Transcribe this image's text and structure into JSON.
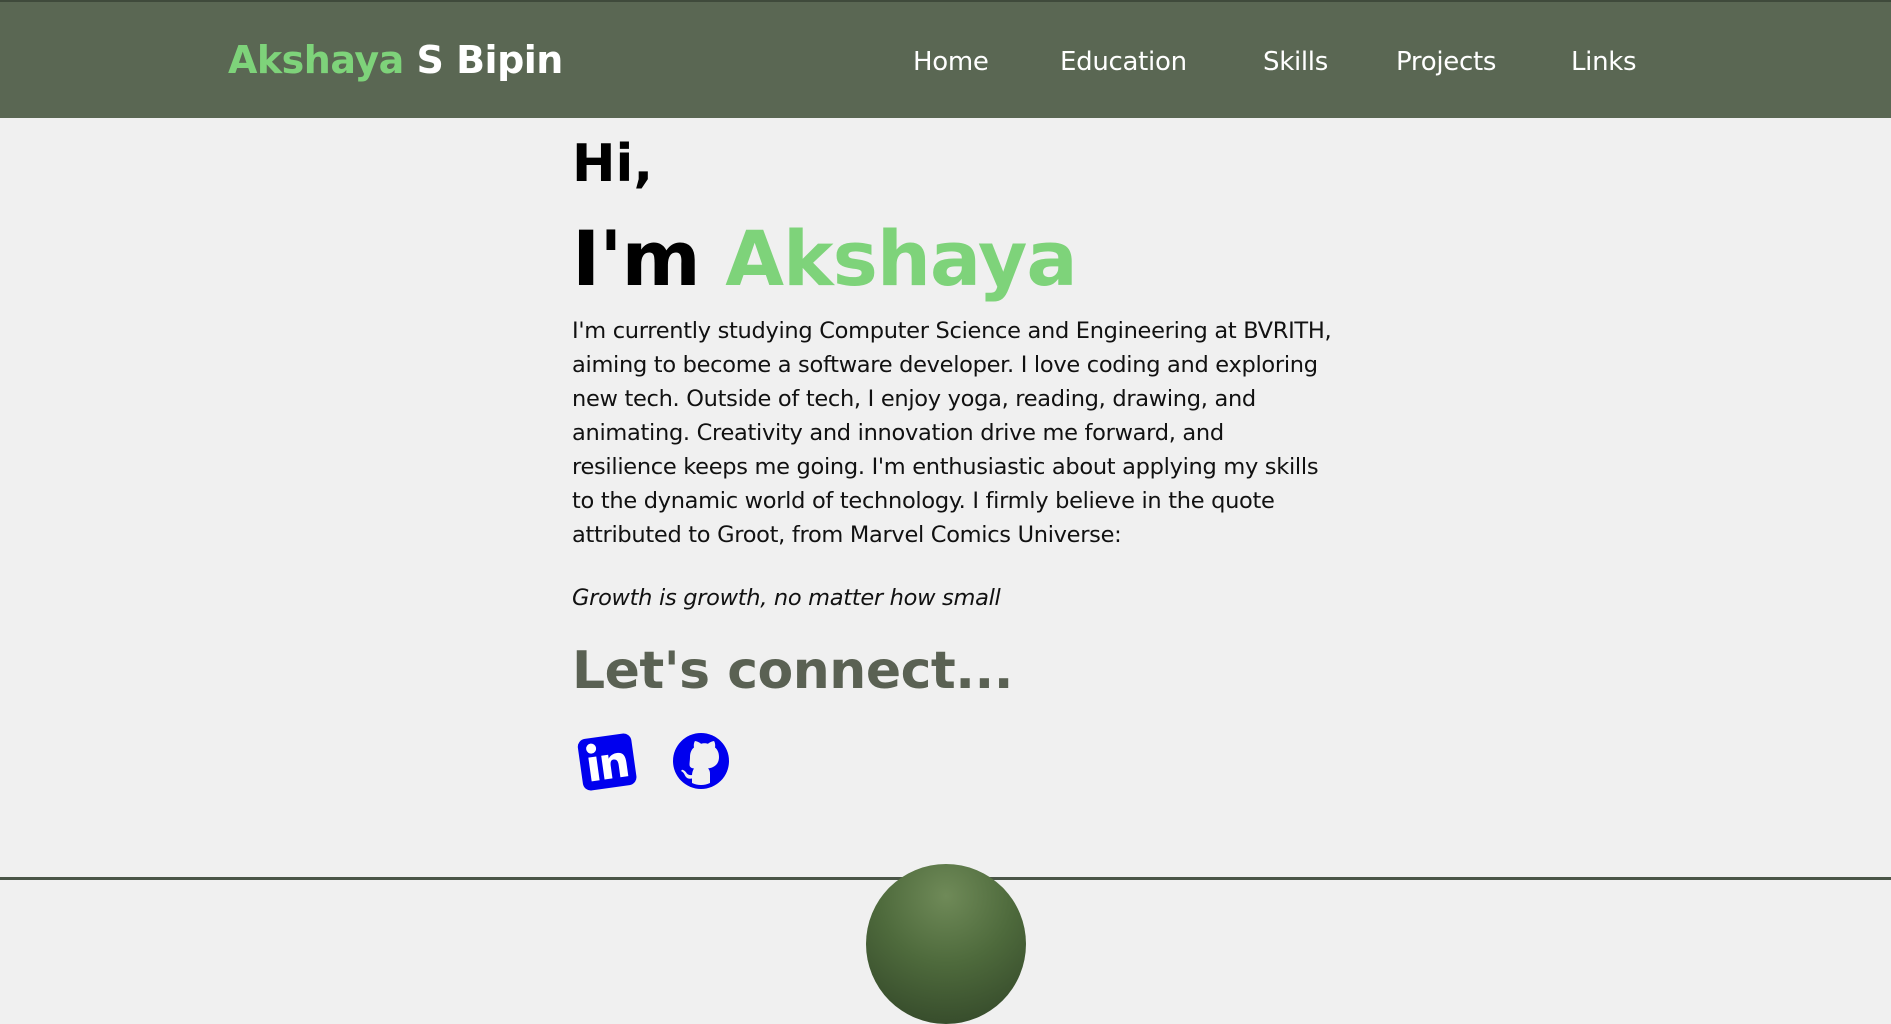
{
  "brand": {
    "first": "Akshaya",
    "rest": "S Bipin"
  },
  "nav": {
    "items": [
      {
        "label": "Home"
      },
      {
        "label": "Education"
      },
      {
        "label": "Skills"
      },
      {
        "label": "Projects"
      },
      {
        "label": "Links"
      }
    ]
  },
  "hero": {
    "greeting": "Hi,",
    "intro_prefix": "I'm",
    "intro_name": "Akshaya",
    "bio": "I'm currently studying Computer Science and Engineering at BVRITH, aiming to become a software developer. I love coding and exploring new tech. Outside of tech, I enjoy yoga, reading, drawing, and animating. Creativity and innovation drive me forward, and resilience keeps me going. I'm enthusiastic about applying my skills to the dynamic world of technology. I firmly believe in the quote attributed to Groot, from Marvel Comics Universe:",
    "quote": "Growth is growth, no matter how small"
  },
  "connect": {
    "heading": "Let's connect...",
    "icons": [
      "linkedin-icon",
      "github-icon"
    ]
  },
  "colors": {
    "navbar": "#5a6753",
    "accent": "#7ed37a",
    "heading_gray": "#5a6153",
    "social_blue": "#0000ee",
    "background": "#f0f0f0"
  }
}
